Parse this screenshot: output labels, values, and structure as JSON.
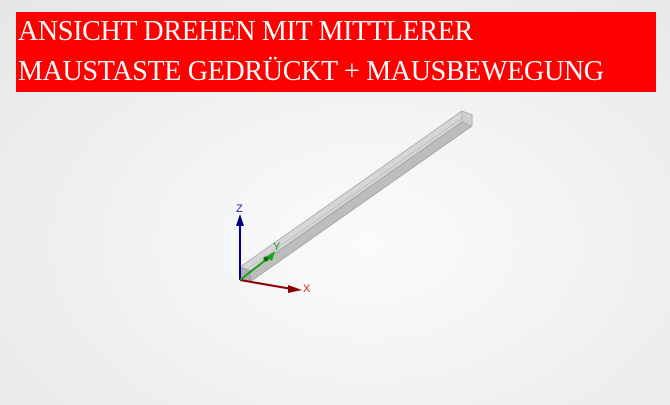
{
  "banner": {
    "line1": "ANSICHT DREHEN MIT MITTLERER",
    "line2": "MAUSTASTE GEDRÜCKT + MAUSBEWEGUNG",
    "background": "#ff0000",
    "text_color": "#ffffff"
  },
  "axes": {
    "x_label": "X",
    "y_label": "Y",
    "z_label": "Z",
    "x_color": "#8b0000",
    "y_color": "#1aa31a",
    "z_color": "#00008b",
    "x_label_color": "#cc2222",
    "z_label_color": "#2222aa"
  },
  "model": {
    "description_icon": "beam-3d-model",
    "face_color": "#c4c4c4",
    "edge_color": "#9a9a9a"
  }
}
